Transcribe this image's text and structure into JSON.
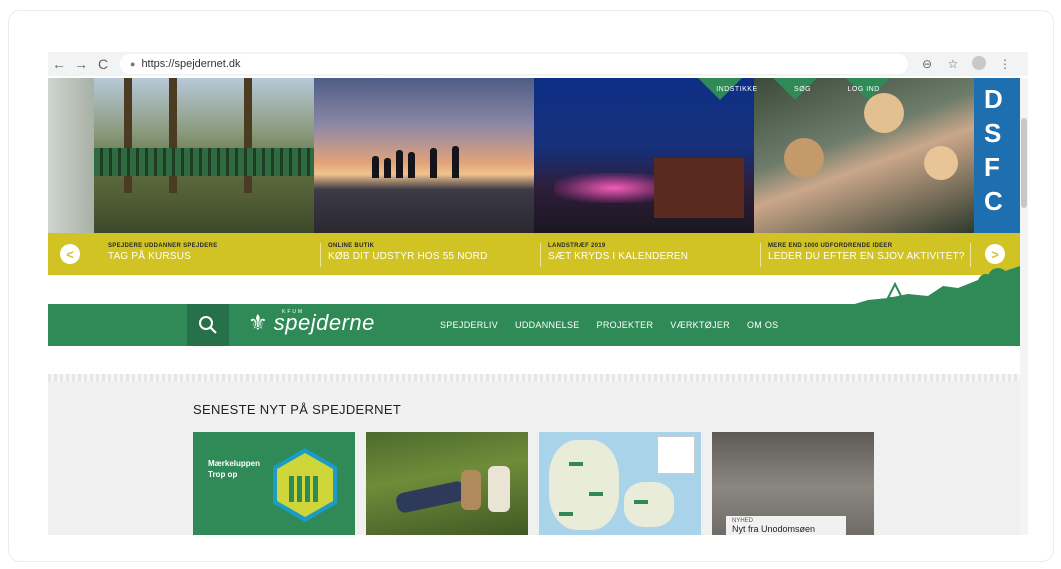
{
  "browser": {
    "url": "https://spejdernet.dk",
    "back_icon": "←",
    "forward_icon": "→",
    "reload_icon": "C",
    "lock_icon": "🔒",
    "zoom_icon": "⊖",
    "star_icon": "☆",
    "menu_icon": "⋮"
  },
  "header_links": [
    "INDSTIKKE",
    "SØG",
    "LOG IND"
  ],
  "carousel": {
    "prev_label": "<",
    "next_label": ">",
    "slides": [
      {
        "category": "SPEJDERE UDDANNER SPEJDERE",
        "headline": "TAG PÅ KURSUS"
      },
      {
        "category": "ONLINE BUTIK",
        "headline": "KØB DIT UDSTYR HOS 55 NORD"
      },
      {
        "category": "LANDSTRÆF 2019",
        "headline": "SÆT KRYDS I KALENDEREN"
      },
      {
        "category": "MERE END 1000 UDFORDRENDE IDEER",
        "headline": "LEDER DU EFTER EN SJOV AKTIVITET?"
      }
    ],
    "partial_right_text": "D S F C"
  },
  "nav": {
    "search_icon": "search-icon",
    "logo_top": "KFUM",
    "logo_name": "spejderne",
    "menu": [
      "SPEJDERLIV",
      "UDDANNELSE",
      "PROJEKTER",
      "VÆRKTØJER",
      "OM OS"
    ]
  },
  "news": {
    "title": "SENESTE NYT PÅ SPEJDERNET",
    "tile1_line1": "Mærkeluppen",
    "tile1_line2": "Trop op",
    "tile4_kicker": "NYHED",
    "tile4_headline": "Nyt fra Unodomsøen"
  },
  "colors": {
    "green": "#2f8a57",
    "yellow": "#d2c324"
  }
}
